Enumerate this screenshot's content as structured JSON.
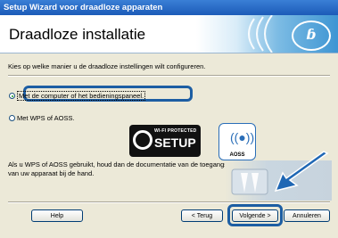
{
  "window": {
    "title": "Setup Wizard voor draadloze apparaten"
  },
  "header": {
    "title": "Draadloze installatie",
    "logo_text": "ɓ"
  },
  "main": {
    "prompt": "Kies op welke manier u de draadloze instellingen wilt configureren.",
    "options": [
      {
        "label": "Met de computer of het bedieningspaneel.",
        "selected": true
      },
      {
        "label": "Met WPS of AOSS.",
        "selected": false
      }
    ],
    "wps_logo": {
      "small_text": "WI-FI PROTECTED",
      "big_text": "SETUP"
    },
    "aoss_logo": {
      "text": "AOSS"
    },
    "description": "Als u WPS of AOSS gebruikt, houd dan de documentatie van de toegangspoort en de Installatiehandleiding van uw apparaat bij de hand."
  },
  "buttons": {
    "help": "Help",
    "back": "< Terug",
    "next": "Volgende >",
    "cancel": "Annuleren"
  },
  "colors": {
    "titlebar": "#1c5bb8",
    "highlight": "#1d5ea3",
    "panel": "#ece9d8",
    "arrow": "#1f67b4"
  }
}
